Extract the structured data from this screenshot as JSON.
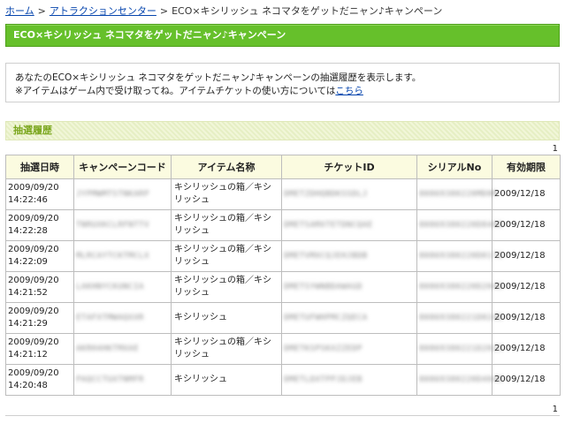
{
  "breadcrumb": {
    "home": "ホーム",
    "sep1": ">",
    "attraction": "アトラクションセンター",
    "sep2": ">",
    "current": "ECO×キシリッシュ ネコマタをゲットだニャン♪キャンペーン"
  },
  "banner": {
    "title": "ECO×キシリッシュ ネコマタをゲットだニャン♪キャンペーン"
  },
  "intro": {
    "line1": "あなたのECO×キシリッシュ ネコマタをゲットだニャン♪キャンペーンの抽選履歴を表示します。",
    "line2_prefix": "※アイテムはゲーム内で受け取ってね。アイテムチケットの使い方については",
    "line2_link": "こちら"
  },
  "section": {
    "title": "抽選履歴"
  },
  "pager": {
    "top": "1",
    "bottom": "1"
  },
  "table": {
    "headers": [
      "抽選日時",
      "キャンペーンコード",
      "アイテム名称",
      "チケットID",
      "シリアルNo",
      "有効期限"
    ],
    "rows": [
      {
        "date": "2009/09/20",
        "time": "14:22:46",
        "code": "JYPMWMTSTNKARP",
        "item": "キシリッシュの箱／キシリッシュ",
        "ticket": "DMETZDHQBDKSSDLJ",
        "serial": "80869380220MD0M",
        "expire": "2009/12/18"
      },
      {
        "date": "2009/09/20",
        "time": "14:22:28",
        "code": "TNRUXKCLRFNTTV",
        "item": "キシリッシュの箱／キシリッシュ",
        "ticket": "DMETSAMXTETDNCQAE",
        "serial": "80869380220D8400",
        "expire": "2009/12/18"
      },
      {
        "date": "2009/09/20",
        "time": "14:22:09",
        "code": "MLRCAYTCKTMCLX",
        "item": "キシリッシュの箱／キシリッシュ",
        "ticket": "DMETVMXCQJEHJBDB",
        "serial": "80869380220D0176",
        "expire": "2009/12/18"
      },
      {
        "date": "2009/09/20",
        "time": "14:21:52",
        "code": "LAKHNYCKUNCIA",
        "item": "キシリッシュの箱／キシリッシュ",
        "ticket": "DMETSYWNBDAWAGD",
        "serial": "80869380220D2040",
        "expire": "2009/12/18"
      },
      {
        "date": "2009/09/20",
        "time": "14:21:29",
        "code": "ETAFXTMWAQXXR",
        "item": "キシリッシュ",
        "ticket": "DMETUFWHPMCZQECA",
        "serial": "80869380221D0240",
        "expire": "2009/12/18"
      },
      {
        "date": "2009/09/20",
        "time": "14:21:12",
        "code": "AKRH4HKTMXAE",
        "item": "キシリッシュの箱／キシリッシュ",
        "ticket": "DMETKSPSKXZZEDP",
        "serial": "80869380221D2025",
        "expire": "2009/12/18"
      },
      {
        "date": "2009/09/20",
        "time": "14:20:48",
        "code": "PAQCCTUXTNMFR",
        "item": "キシリッシュ",
        "ticket": "DMETLDXTPPJDJEB",
        "serial": "80869380220D4040",
        "expire": "2009/12/18"
      }
    ]
  }
}
